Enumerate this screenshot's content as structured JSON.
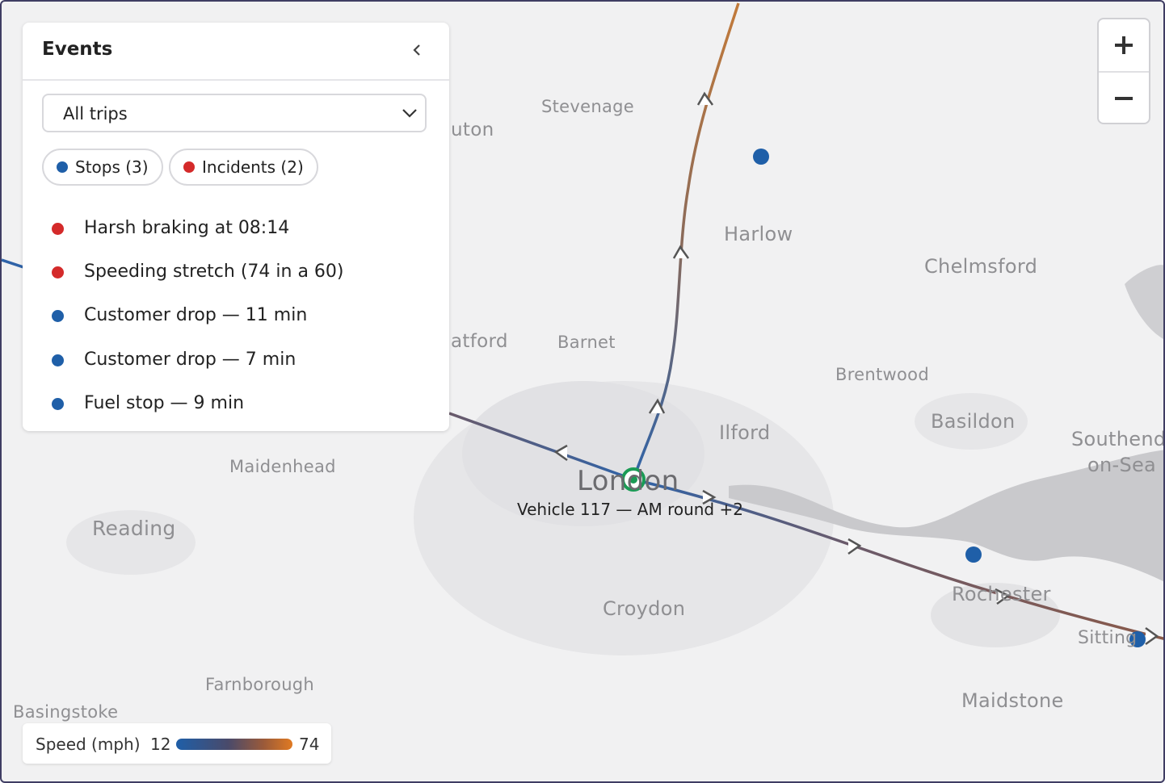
{
  "map": {
    "places": [
      {
        "name": "Stevenage",
        "size": "md"
      },
      {
        "name": "Luton",
        "size": "md"
      },
      {
        "name": "Harlow",
        "size": "md"
      },
      {
        "name": "Chelmsford",
        "size": "md"
      },
      {
        "name": "Watford",
        "size": "md"
      },
      {
        "name": "Barnet",
        "size": "sm"
      },
      {
        "name": "Brentwood",
        "size": "sm"
      },
      {
        "name": "Basildon",
        "size": "md"
      },
      {
        "name": "Southend-",
        "size": "md"
      },
      {
        "name": "on-Sea",
        "size": "md"
      },
      {
        "name": "Ilford",
        "size": "md"
      },
      {
        "name": "Maidenhead",
        "size": "sm"
      },
      {
        "name": "London",
        "size": "lg"
      },
      {
        "name": "Reading",
        "size": "md"
      },
      {
        "name": "Croydon",
        "size": "md"
      },
      {
        "name": "Rochester",
        "size": "md"
      },
      {
        "name": "Sittingbourne",
        "size": "sm"
      },
      {
        "name": "Maidstone",
        "size": "md"
      },
      {
        "name": "Farnborough",
        "size": "sm"
      },
      {
        "name": "Basingstoke",
        "size": "sm"
      }
    ],
    "vehicle_label": "Vehicle 117 —  AM round +2",
    "colors": {
      "stop": "#1f5fa8",
      "incident": "#d42a2a",
      "vehicle": "#1a9b55",
      "route_slow": "#1f5fa8",
      "route_fast": "#e07a22"
    }
  },
  "panel": {
    "title": "Events",
    "collapse_icon": "chevron-left-icon",
    "filter": {
      "selected": "All trips"
    },
    "chips": [
      {
        "label": "Stops (3)",
        "color": "#1f5fa8"
      },
      {
        "label": "Incidents (2)",
        "color": "#d42a2a"
      }
    ],
    "events": [
      {
        "label": "Harsh braking at 08:14",
        "type": "incident",
        "color": "#d42a2a"
      },
      {
        "label": "Speeding stretch (74 in a 60)",
        "type": "incident",
        "color": "#d42a2a"
      },
      {
        "label": "Customer drop — 11 min",
        "type": "stop",
        "color": "#1f5fa8"
      },
      {
        "label": "Customer drop — 7 min",
        "type": "stop",
        "color": "#1f5fa8"
      },
      {
        "label": "Fuel stop — 9 min",
        "type": "stop",
        "color": "#1f5fa8"
      }
    ]
  },
  "zoom": {
    "in_icon": "plus-icon",
    "out_icon": "minus-icon"
  },
  "legend": {
    "label": "Speed (mph)",
    "min": "12",
    "max": "74"
  }
}
